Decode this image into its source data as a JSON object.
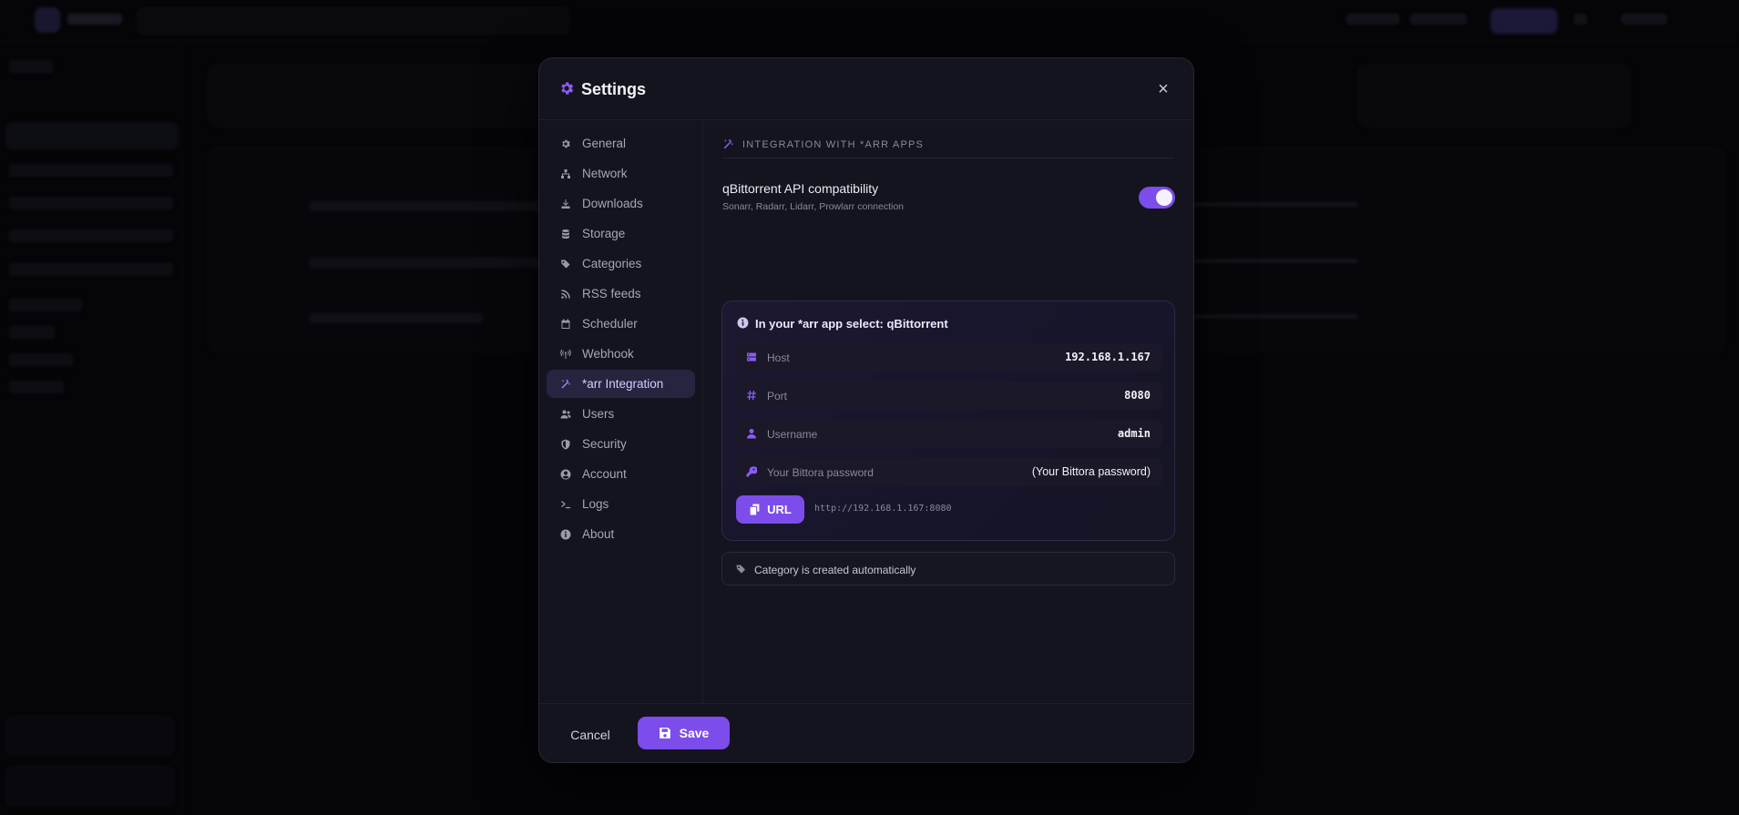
{
  "modal": {
    "title": "Settings",
    "close_glyph": "×"
  },
  "nav": {
    "items": [
      {
        "label": "General",
        "icon": "gear-icon"
      },
      {
        "label": "Network",
        "icon": "network-icon"
      },
      {
        "label": "Downloads",
        "icon": "download-icon"
      },
      {
        "label": "Storage",
        "icon": "database-icon"
      },
      {
        "label": "Categories",
        "icon": "tags-icon"
      },
      {
        "label": "RSS feeds",
        "icon": "rss-icon"
      },
      {
        "label": "Scheduler",
        "icon": "calendar-icon"
      },
      {
        "label": "Webhook",
        "icon": "broadcast-icon"
      },
      {
        "label": "*arr Integration",
        "icon": "magic-wand-icon",
        "active": true
      },
      {
        "label": "Users",
        "icon": "users-icon"
      },
      {
        "label": "Security",
        "icon": "shield-icon"
      },
      {
        "label": "Account",
        "icon": "user-circle-icon"
      },
      {
        "label": "Logs",
        "icon": "terminal-icon"
      },
      {
        "label": "About",
        "icon": "info-icon"
      }
    ]
  },
  "section": {
    "title": "INTEGRATION WITH *ARR APPS",
    "icon": "magic-wand-icon"
  },
  "toggle": {
    "label": "qBittorrent API compatibility",
    "sublabel": "Sonarr, Radarr, Lidarr, Prowlarr connection",
    "enabled": true
  },
  "info_card": {
    "title": "In your *arr app select: qBittorrent",
    "fields": [
      {
        "key": "Host",
        "value": "192.168.1.167",
        "icon": "server-icon"
      },
      {
        "key": "Port",
        "value": "8080",
        "icon": "hash-icon"
      },
      {
        "key": "Username",
        "value": "admin",
        "icon": "user-icon"
      },
      {
        "key": "Your Bittora password",
        "value": "(Your Bittora password)",
        "icon": "key-icon"
      }
    ],
    "url_button": "URL",
    "url_value": "http://192.168.1.167:8080"
  },
  "note": {
    "text": "Category is created automatically",
    "icon": "tags-icon"
  },
  "footer": {
    "cancel": "Cancel",
    "save": "Save"
  },
  "colors": {
    "accent": "#7c4dea",
    "accent_light": "#8b5cf6",
    "modal_bg": "#14141f",
    "page_bg": "#050508"
  }
}
